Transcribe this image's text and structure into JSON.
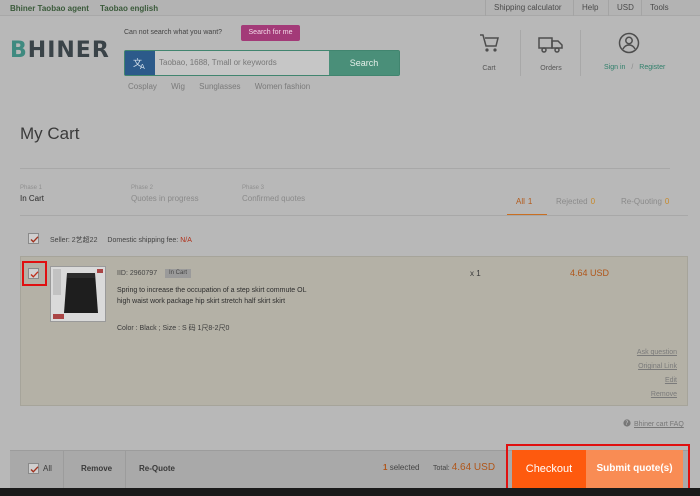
{
  "topbar": {
    "left": [
      "Bhiner Taobao agent",
      "Taobao english"
    ],
    "right": [
      "Shipping calculator",
      "Help",
      "USD",
      "Tools"
    ]
  },
  "header": {
    "logo_first": "B",
    "logo_rest": "HINER",
    "search_hint": "Can not search what you want?",
    "search_for_me": "Search for me",
    "search_placeholder": "Taobao, 1688, Tmall or keywords",
    "search_button": "Search",
    "hot_words": [
      "Cosplay",
      "Wig",
      "Sunglasses",
      "Women fashion"
    ],
    "cart_label": "Cart",
    "orders_label": "Orders",
    "sign_in": "Sign in",
    "register": "Register"
  },
  "page_title": "My Cart",
  "phases": [
    {
      "num": "Phase 1",
      "label": "In Cart"
    },
    {
      "num": "Phase 2",
      "label": "Quotes in progress"
    },
    {
      "num": "Phase 3",
      "label": "Confirmed quotes"
    }
  ],
  "filters": [
    {
      "label": "All",
      "count": "1"
    },
    {
      "label": "Rejected",
      "count": "0"
    },
    {
      "label": "Re-Quoting",
      "count": "0"
    }
  ],
  "seller": {
    "label": "Seller: 2艺超22",
    "shipping_label": "Domestic shipping fee:",
    "shipping_value": "N/A"
  },
  "item": {
    "iid": "IID: 2960797",
    "status": "In Cart",
    "description": "Spring to increase the occupation of a step skirt commute OL high waist work package hip skirt stretch half skirt skirt",
    "variant": "Color : Black ; Size : S 码 1尺8-2尺0",
    "qty": "x 1",
    "price": "4.64 USD",
    "actions": [
      "Ask question",
      "Original Link",
      "Edit",
      "Remove"
    ]
  },
  "faq": "Bhiner cart FAQ",
  "footer": {
    "all": "All",
    "remove": "Remove",
    "requote": "Re-Quote",
    "selected_count": "1",
    "selected_label": "selected",
    "total_label": "Total:",
    "total_value": "4.64 USD",
    "checkout": "Checkout",
    "submit": "Submit quote(s)"
  },
  "colors": {
    "accent_orange": "#fe5a0e",
    "submit_orange": "#f98c54",
    "highlight_red": "#e01010",
    "brand_green": "#4a8f79"
  }
}
